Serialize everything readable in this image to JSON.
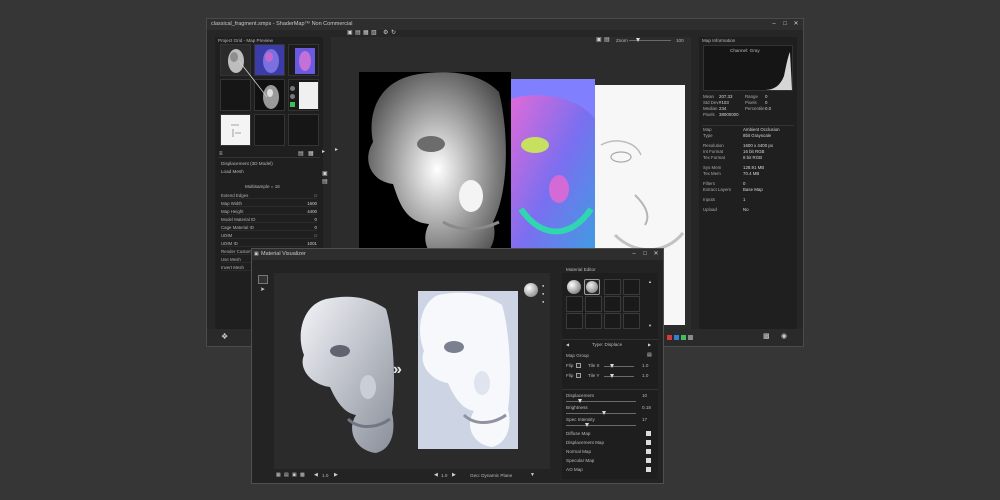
{
  "main_window": {
    "title": "classical_fragment.smps - ShaderMap™ Non Commercial",
    "controls": [
      "–",
      "□",
      "✕"
    ],
    "toolbar_icons": [
      "new-file-icon",
      "open-icon",
      "save-icon",
      "save-all-icon",
      "export-icon",
      "settings-icon",
      "refresh-icon"
    ],
    "project_panel_title": "Project Grid - Map Preview",
    "properties_header": "Displacement (3D Model)",
    "properties_sub": "Load Mesh",
    "multisample_label": "Multisample = 16",
    "properties": [
      {
        "key": "Extend Edges",
        "value": "□"
      },
      {
        "key": "Map Width",
        "value": "1600"
      },
      {
        "key": "Map Height",
        "value": "4400"
      },
      {
        "key": "Model Material ID",
        "value": "0"
      },
      {
        "key": "Cage Material ID",
        "value": "0"
      },
      {
        "key": "UDIM",
        "value": "□"
      },
      {
        "key": "UDIM ID",
        "value": "1001"
      },
      {
        "key": "Render Custom",
        "value": ""
      },
      {
        "key": "Use Mesh",
        "value": ""
      },
      {
        "key": "Invert Mesh",
        "value": ""
      }
    ],
    "zoom_label": "Zoom",
    "zoom_value": "100",
    "map_info_title": "Map Information",
    "histogram_label": "Channel: Gray",
    "stats": [
      {
        "k": "Mean",
        "v": "207.33",
        "k2": "Range",
        "v2": "0"
      },
      {
        "k": "Std Dev",
        "v": "#103",
        "k2": "Pixels",
        "v2": "0"
      },
      {
        "k": "Median",
        "v": "234",
        "k2": "Percentile",
        "v2": "0.0"
      },
      {
        "k": "Pixels",
        "v": "38000000",
        "k2": "",
        "v2": ""
      }
    ],
    "map_info": [
      {
        "k": "Map",
        "v": "Ambient Occlusion"
      },
      {
        "k": "Type",
        "v": "8bit Grayscale"
      },
      {
        "k": "Resolution",
        "v": "1600 x 4400 px"
      },
      {
        "k": "Int Format",
        "v": "16 bit RGB"
      },
      {
        "k": "Tex Format",
        "v": "8 bit RGB"
      },
      {
        "k": "Sys Mem",
        "v": "128.91 MB"
      },
      {
        "k": "Tex Mem",
        "v": "70.4 MB"
      },
      {
        "k": "Filters",
        "v": "0"
      },
      {
        "k": "Extract Layers",
        "v": "Base Map"
      },
      {
        "k": "Inputs",
        "v": "1"
      },
      {
        "k": "Upload",
        "v": "No"
      }
    ],
    "statusbar_swatches": [
      "#d23b3b",
      "#3a7bd5",
      "#3dbf5a",
      "#8a8a8a"
    ]
  },
  "material_window": {
    "title": "Material Visualizer",
    "controls": [
      "–",
      "□",
      "✕"
    ],
    "arrow": "»",
    "editor_title": "Material Editor",
    "type_title": "Type: Displace",
    "map_group": "Map Group",
    "flip_rows": [
      {
        "label": "Flip",
        "axis": "Tile X",
        "value": "1.0"
      },
      {
        "label": "Flip",
        "axis": "Tile Y",
        "value": "1.0"
      }
    ],
    "sliders": [
      {
        "label": "Displacement",
        "value": "10",
        "level": 0.2
      },
      {
        "label": "Brightness",
        "value": "0.18",
        "level": 0.55
      },
      {
        "label": "Spec Intensity",
        "value": "17",
        "level": 0.3
      }
    ],
    "toggles": [
      {
        "label": "Diffuse Map",
        "on": true
      },
      {
        "label": "Displacement Map",
        "on": true
      },
      {
        "label": "Normal Map",
        "on": true
      },
      {
        "label": "Specular Map",
        "on": true
      },
      {
        "label": "AO Map",
        "on": true
      }
    ],
    "statusbar_left": "1.0",
    "statusbar_mid": "1.0",
    "statusbar_right": "Geo: Dynamic Plane"
  }
}
